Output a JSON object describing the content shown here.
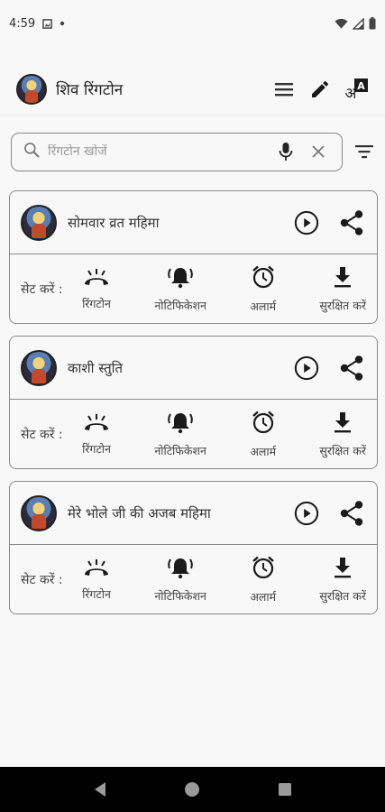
{
  "status_bar": {
    "time": "4:59",
    "icons_left": [
      "image-notification-icon",
      "dot-icon"
    ],
    "icons_right": [
      "wifi-icon",
      "signal-icon",
      "battery-icon"
    ]
  },
  "app_bar": {
    "title": "शिव रिंगटोन",
    "actions": [
      "menu-icon",
      "edit-icon",
      "translate-icon"
    ]
  },
  "search": {
    "placeholder": "रिंगटोन खोजें"
  },
  "set_options": [
    {
      "label": "रिंगटोन",
      "icon": "ringtone-phone-icon"
    },
    {
      "label": "नोटिफिकेशन",
      "icon": "bell-icon"
    },
    {
      "label": "अलार्म",
      "icon": "alarm-clock-icon"
    },
    {
      "label": "सुरक्षित करें",
      "icon": "download-icon"
    }
  ],
  "set_label": "सेट करें :",
  "tracks": [
    {
      "title": "सोमवार व्रत महिमा"
    },
    {
      "title": "काशी स्तुति"
    },
    {
      "title": "मेरे भोले जी की अजब महिमा"
    }
  ],
  "colors": {
    "background": "#f8f8f8",
    "border": "#8a8a8a",
    "icon": "#1a1a1a",
    "nav_bar": "#000000"
  }
}
